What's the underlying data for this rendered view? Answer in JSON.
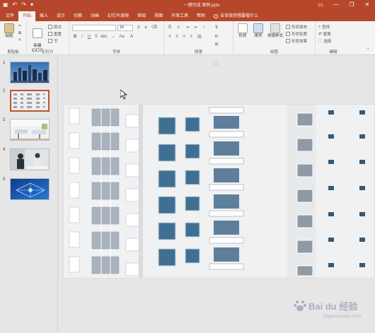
{
  "titlebar": {
    "document_title": "一键完成 案例.pptx",
    "save_icon": "save-icon",
    "undo_icon": "undo-icon",
    "redo_icon": "redo-icon",
    "minimize": "—",
    "restore": "❐",
    "close": "✕"
  },
  "tabs": [
    {
      "label": "文件"
    },
    {
      "label": "开始"
    },
    {
      "label": "插入"
    },
    {
      "label": "设计"
    },
    {
      "label": "切换"
    },
    {
      "label": "动画"
    },
    {
      "label": "幻灯片放映"
    },
    {
      "label": "审阅"
    },
    {
      "label": "视图"
    },
    {
      "label": "开发工具"
    },
    {
      "label": "帮助"
    }
  ],
  "tell_me": "告诉我你想要做什么",
  "ribbon": {
    "clipboard": {
      "label": "剪贴板",
      "paste": "粘贴"
    },
    "slides": {
      "label": "幻灯片",
      "new_slide": "新建\n幻灯片",
      "layout": "版式",
      "reset": "重置",
      "section": "节"
    },
    "font": {
      "label": "字体",
      "size": "16"
    },
    "paragraph": {
      "label": "段落"
    },
    "drawing": {
      "label": "绘图",
      "shapes": "形状",
      "arrange": "排列",
      "quick_styles": "快速样式",
      "fill": "形状填充",
      "outline": "形状轮廓",
      "effects": "形状效果"
    },
    "editing": {
      "label": "编辑",
      "find": "查找",
      "replace": "替换",
      "select": "选择"
    }
  },
  "slides": [
    {
      "number": "1"
    },
    {
      "number": "2"
    },
    {
      "number": "3"
    },
    {
      "number": "4"
    },
    {
      "number": "5"
    }
  ],
  "watermark": {
    "text": "Bai du 经验",
    "sub": "jingyan.baidu.com"
  }
}
